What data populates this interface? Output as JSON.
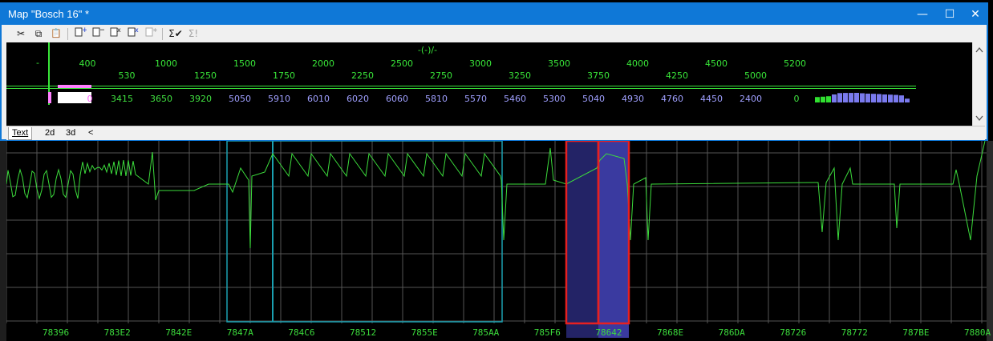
{
  "window": {
    "title": "Map \"Bosch 16\" *",
    "minimize": "—",
    "maximize": "☐",
    "close": "✕"
  },
  "toolbar": {
    "cut": "✂",
    "copy": "⧉",
    "paste": "📋",
    "add_row": "+",
    "remove_row": "−",
    "multiply": "x",
    "multiply_alt": "x",
    "disabled_op": "∗",
    "sum_check": "Σ✔",
    "sum": "Σ!"
  },
  "map": {
    "header_label": "-(-)/-",
    "corner_label": "-",
    "x_axis_row1": [
      "400",
      "1000",
      "1500",
      "2000",
      "2500",
      "3000",
      "3500",
      "4000",
      "4500",
      "5200"
    ],
    "x_axis_row2": [
      "530",
      "1250",
      "1750",
      "2250",
      "2750",
      "3250",
      "3750",
      "4250",
      "5000"
    ],
    "values_row": [
      "0",
      "3415",
      "3650",
      "3920",
      "5050",
      "5910",
      "6010",
      "6020",
      "6060",
      "5810",
      "5570",
      "5460",
      "5300",
      "5040",
      "4930",
      "4760",
      "4450",
      "2400",
      "0"
    ]
  },
  "tabs": [
    "Text",
    "2d",
    "3d"
  ],
  "scroll_left": "<",
  "addresses": [
    "78396",
    "783E2",
    "7842E",
    "7847A",
    "784C6",
    "78512",
    "7855E",
    "785AA",
    "785F6",
    "78642",
    "7868E",
    "786DA",
    "78726",
    "78772",
    "787BE",
    "7880A"
  ],
  "colors": {
    "title_bar": "#0f78d7",
    "trace": "#3cdc3c",
    "grid": "#555555",
    "selection_red": "#e82020",
    "selection_fill": "#3a3aa0",
    "value_blue": "#a0a0ff",
    "value_green": "#40e040",
    "cyan_box": "#1aa0b0"
  }
}
